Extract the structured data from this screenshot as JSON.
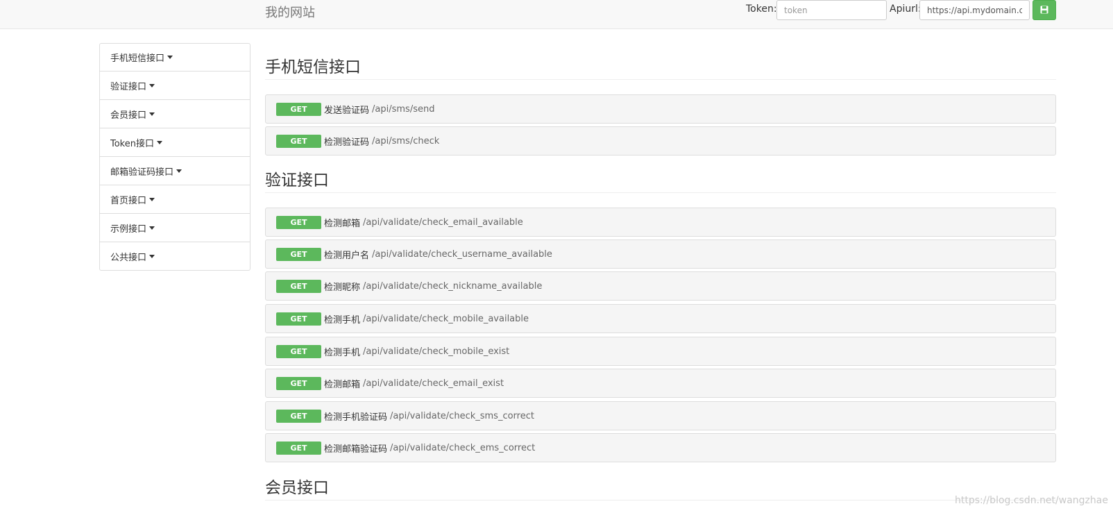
{
  "header": {
    "brand": "我的网站",
    "token_label": "Token:",
    "token_placeholder": "token",
    "apiurl_label": "Apiurl:",
    "apiurl_value": "https://api.mydomain.con",
    "save_icon": "floppy-disk-icon"
  },
  "sidebar": {
    "items": [
      {
        "label": "手机短信接口"
      },
      {
        "label": "验证接口"
      },
      {
        "label": "会员接口"
      },
      {
        "label": "Token接口"
      },
      {
        "label": "邮箱验证码接口"
      },
      {
        "label": "首页接口"
      },
      {
        "label": "示例接口"
      },
      {
        "label": "公共接口"
      }
    ]
  },
  "sections": [
    {
      "title": "手机短信接口",
      "endpoints": [
        {
          "method": "GET",
          "name": "发送验证码",
          "path": "/api/sms/send"
        },
        {
          "method": "GET",
          "name": "检测验证码",
          "path": "/api/sms/check"
        }
      ]
    },
    {
      "title": "验证接口",
      "endpoints": [
        {
          "method": "GET",
          "name": "检测邮箱",
          "path": "/api/validate/check_email_available"
        },
        {
          "method": "GET",
          "name": "检测用户名",
          "path": "/api/validate/check_username_available"
        },
        {
          "method": "GET",
          "name": "检测昵称",
          "path": "/api/validate/check_nickname_available"
        },
        {
          "method": "GET",
          "name": "检测手机",
          "path": "/api/validate/check_mobile_available"
        },
        {
          "method": "GET",
          "name": "检测手机",
          "path": "/api/validate/check_mobile_exist"
        },
        {
          "method": "GET",
          "name": "检测邮箱",
          "path": "/api/validate/check_email_exist"
        },
        {
          "method": "GET",
          "name": "检测手机验证码",
          "path": "/api/validate/check_sms_correct"
        },
        {
          "method": "GET",
          "name": "检测邮箱验证码",
          "path": "/api/validate/check_ems_correct"
        }
      ]
    },
    {
      "title": "会员接口",
      "endpoints": []
    }
  ],
  "watermark": "https://blog.csdn.net/wangzhae",
  "colors": {
    "accent": "#5cb85c",
    "endpoint_bg": "#f5f5f5",
    "navbar_bg": "#f8f8f8"
  }
}
